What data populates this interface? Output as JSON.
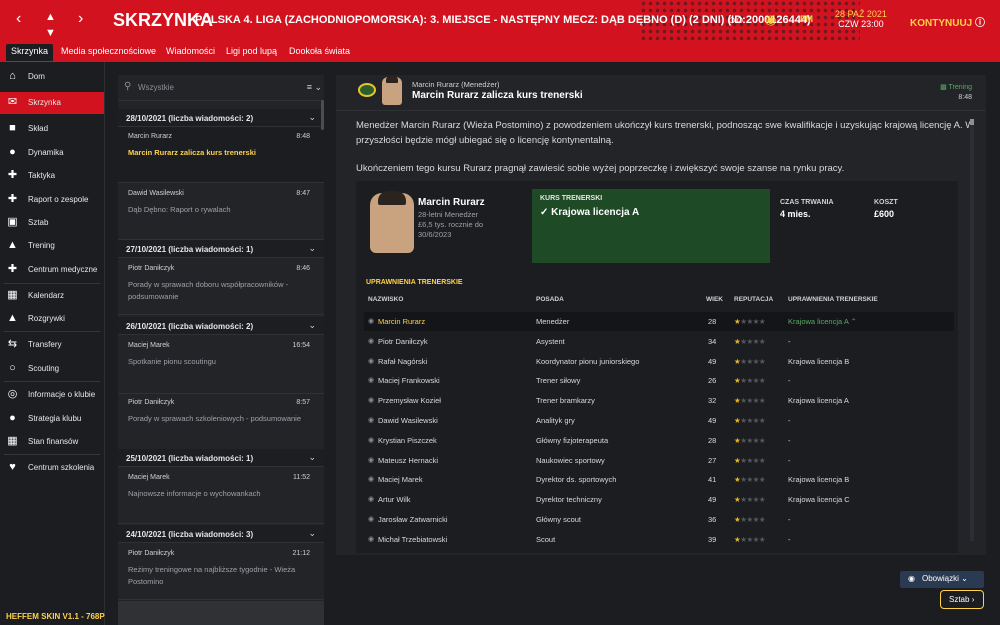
{
  "header": {
    "title": "SKRZYNKA",
    "subtitle": "POLSKA 4. LIGA (ZACHODNIOPOMORSKA): 3. MIEJSCE - NASTĘPNY MECZ: DĄB DĘBNO (D) (2 DNI) (ID:2000126444)",
    "date_line1": "28 PAŹ 2021",
    "date_line2": "CZW 23:00",
    "fm_label": "FM",
    "continue_label": "KONTYNUUJ"
  },
  "tabs": [
    {
      "label": "Skrzynka"
    },
    {
      "label": "Media społecznościowe"
    },
    {
      "label": "Wiadomości"
    },
    {
      "label": "Ligi pod lupą"
    },
    {
      "label": "Dookoła świata"
    }
  ],
  "sidebar": {
    "items": [
      {
        "label": "Dom",
        "icon": "home-icon"
      },
      {
        "label": "Skrzynka",
        "icon": "inbox-icon"
      },
      {
        "label": "Skład",
        "icon": "shirt-icon"
      },
      {
        "label": "Dynamika",
        "icon": "dynamics-icon"
      },
      {
        "label": "Taktyka",
        "icon": "tactics-icon"
      },
      {
        "label": "Raport o zespole",
        "icon": "report-icon"
      },
      {
        "label": "Sztab",
        "icon": "staff-icon"
      },
      {
        "label": "Trening",
        "icon": "training-icon"
      },
      {
        "label": "Centrum medyczne",
        "icon": "medical-icon"
      },
      {
        "label": "Kalendarz",
        "icon": "calendar-icon"
      },
      {
        "label": "Rozgrywki",
        "icon": "trophy-icon"
      },
      {
        "label": "Transfery",
        "icon": "transfers-icon"
      },
      {
        "label": "Scouting",
        "icon": "binoculars-icon"
      },
      {
        "label": "Informacje o klubie",
        "icon": "club-icon"
      },
      {
        "label": "Strategia klubu",
        "icon": "strategy-icon"
      },
      {
        "label": "Stan finansów",
        "icon": "finances-icon"
      },
      {
        "label": "Centrum szkolenia",
        "icon": "academy-icon"
      }
    ],
    "skin_label": "HEFFEM SKIN V1.1 - 768P"
  },
  "list": {
    "search_placeholder": "Wszystkie",
    "groups": [
      {
        "label": "28/10/2021 (liczba wiadomości: 2)"
      },
      {
        "label": "27/10/2021 (liczba wiadomości: 1)"
      },
      {
        "label": "26/10/2021 (liczba wiadomości: 2)"
      },
      {
        "label": "25/10/2021 (liczba wiadomości: 1)"
      },
      {
        "label": "24/10/2021 (liczba wiadomości: 3)"
      }
    ],
    "messages": [
      {
        "from": "Marcin Rurarz",
        "time": "8:48",
        "subject": "Marcin Rurarz zalicza kurs trenerski"
      },
      {
        "from": "Dawid Wasilewski",
        "time": "8:47",
        "subject": "Dąb Dębno: Raport o rywalach"
      },
      {
        "from": "Piotr Daniłczyk",
        "time": "8:46",
        "subject": "Porady w sprawach doboru współpracowników - podsumowanie"
      },
      {
        "from": "Maciej Marek",
        "time": "16:54",
        "subject": "Spotkanie pionu scoutingu"
      },
      {
        "from": "Piotr Daniłczyk",
        "time": "8:57",
        "subject": "Porady w sprawach szkoleniowych - podsumowanie"
      },
      {
        "from": "Maciej Marek",
        "time": "11:52",
        "subject": "Najnowsze informacje o wychowankach"
      },
      {
        "from": "Piotr Daniłczyk",
        "time": "21:12",
        "subject": "Reżimy treningowe na najbliższe tygodnie - Wieża Postomino"
      }
    ]
  },
  "detail": {
    "from": "Marcin Rurarz  (Menedżer)",
    "subject": "Marcin Rurarz zalicza kurs trenerski",
    "tag": "Trening",
    "time": "8:48",
    "body1": "Menedżer Marcin Rurarz (Wieża Postomino) z powodzeniem ukończył kurs trenerski, podnosząc swe kwalifikacje i uzyskując krajową licencję A. W przyszłości będzie mógł ubiegać się o licencję kontynentalną.",
    "body2": "Ukończeniem tego kursu Rurarz pragnął zawiesić sobie wyżej poprzeczkę i zwiększyć swoje szanse na rynku pracy.",
    "card": {
      "name": "Marcin Rurarz",
      "meta1": "28-letni Menedżer",
      "meta2": "£6,5 tys. rocznie do 30/6/2023",
      "kurs_label": "KURS TRENERSKI",
      "kurs_value": "Krajowa licencja A",
      "czas_label": "CZAS TRWANIA",
      "czas_value": "4 mies.",
      "koszt_label": "KOSZT",
      "koszt_value": "£600",
      "section_label": "UPRAWNIENIA TRENERSKIE",
      "columns": [
        "NAZWISKO",
        "POSADA",
        "WIEK",
        "REPUTACJA",
        "UPRAWNIENIA TRENERSKIE"
      ],
      "rows": [
        {
          "name": "Marcin Rurarz",
          "role": "Menedżer",
          "age": "28",
          "rep": 1,
          "lic": "Krajowa licencja A"
        },
        {
          "name": "Piotr Daniłczyk",
          "role": "Asystent",
          "age": "34",
          "rep": 1,
          "lic": "-"
        },
        {
          "name": "Rafał Nagórski",
          "role": "Koordynator pionu juniorskiego",
          "age": "49",
          "rep": 1,
          "lic": "Krajowa licencja B"
        },
        {
          "name": "Maciej Frankowski",
          "role": "Trener siłowy",
          "age": "26",
          "rep": 1,
          "lic": "-"
        },
        {
          "name": "Przemysław Kozieł",
          "role": "Trener bramkarzy",
          "age": "32",
          "rep": 1,
          "lic": "Krajowa licencja A"
        },
        {
          "name": "Dawid Wasilewski",
          "role": "Analityk gry",
          "age": "49",
          "rep": 1,
          "lic": "-"
        },
        {
          "name": "Krystian Piszczek",
          "role": "Główny fizjoterapeuta",
          "age": "28",
          "rep": 1,
          "lic": "-"
        },
        {
          "name": "Mateusz Hernacki",
          "role": "Naukowiec sportowy",
          "age": "27",
          "rep": 1,
          "lic": "-"
        },
        {
          "name": "Maciej Marek",
          "role": "Dyrektor ds. sportowych",
          "age": "41",
          "rep": 1,
          "lic": "Krajowa licencja B"
        },
        {
          "name": "Artur Wilk",
          "role": "Dyrektor techniczny",
          "age": "49",
          "rep": 1,
          "lic": "Krajowa licencja C"
        },
        {
          "name": "Jarosław Zatwarnicki",
          "role": "Główny scout",
          "age": "36",
          "rep": 1,
          "lic": "-"
        },
        {
          "name": "Michał Trzebiatowski",
          "role": "Scout",
          "age": "39",
          "rep": 1,
          "lic": "-"
        }
      ]
    }
  },
  "footer": {
    "obowiazki_label": "Obowiązki",
    "sztab_label": "Sztab"
  }
}
